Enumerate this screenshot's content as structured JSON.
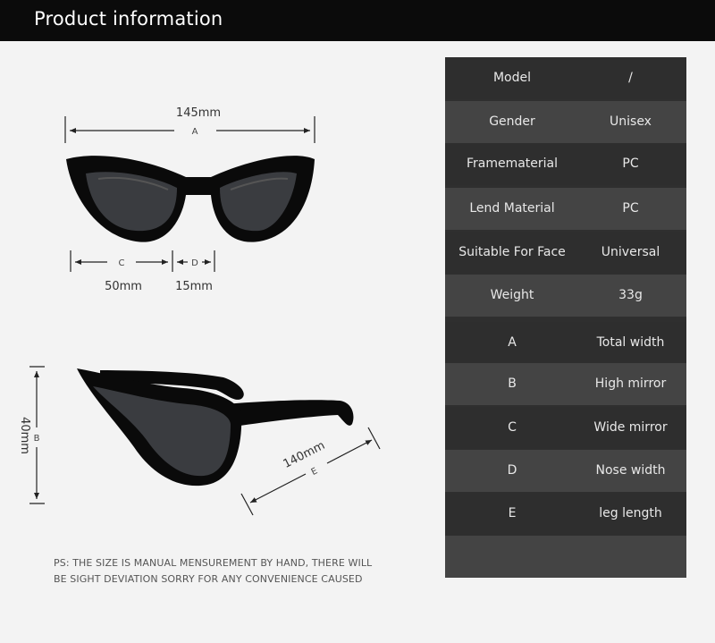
{
  "header": {
    "title": "Product information"
  },
  "front_view": {
    "width_value": "145mm",
    "width_letter": "A",
    "lens_value": "50mm",
    "lens_letter": "C",
    "nose_value": "15mm",
    "nose_letter": "D"
  },
  "side_view": {
    "height_value": "40mm",
    "height_letter": "B",
    "leg_value": "140mm",
    "leg_letter": "E"
  },
  "specs": [
    {
      "label": "Model",
      "value": "/"
    },
    {
      "label": "Gender",
      "value": "Unisex"
    },
    {
      "label": "Framematerial",
      "value": "PC"
    },
    {
      "label": "Lend Material",
      "value": "PC"
    },
    {
      "label": "Suitable For Face",
      "value": "Universal"
    },
    {
      "label": "Weight",
      "value": "33g"
    },
    {
      "label": "A",
      "value": "Total width"
    },
    {
      "label": "B",
      "value": "High mirror"
    },
    {
      "label": "C",
      "value": "Wide mirror"
    },
    {
      "label": "D",
      "value": "Nose width"
    },
    {
      "label": "E",
      "value": "leg length"
    }
  ],
  "note": {
    "line1": "PS: THE SIZE IS MANUAL MENSUREMENT BY HAND, THERE WILL",
    "line2": "BE SIGHT DEVIATION SORRY FOR ANY CONVENIENCE CAUSED"
  }
}
